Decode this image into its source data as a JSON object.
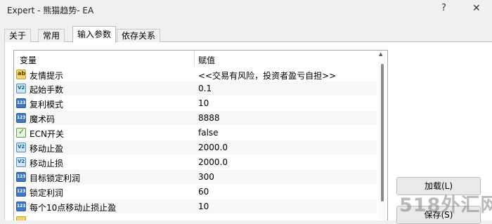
{
  "window": {
    "title": "Expert - 熊猫趋势- EA",
    "help": "?",
    "close": "✕"
  },
  "tabs": [
    {
      "label": "关于"
    },
    {
      "label": "常用"
    },
    {
      "label": "输入参数"
    },
    {
      "label": "依存关系"
    }
  ],
  "grid": {
    "columns": {
      "variable": "变量",
      "value": "赋值"
    },
    "rows": [
      {
        "name": "友情提示",
        "value": "<<交易有风险，投资者盈亏自担>>",
        "icon": "string-icon"
      },
      {
        "name": "起始手数",
        "value": "0.1",
        "icon": "double-icon"
      },
      {
        "name": "复利模式",
        "value": "10",
        "icon": "integer-icon"
      },
      {
        "name": "魔术码",
        "value": "8888",
        "icon": "integer-icon"
      },
      {
        "name": "ECN开关",
        "value": "false",
        "icon": "bool-icon"
      },
      {
        "name": "移动止盈",
        "value": "2000.0",
        "icon": "double-icon"
      },
      {
        "name": "移动止损",
        "value": "2000.0",
        "icon": "double-icon"
      },
      {
        "name": "目标锁定利润",
        "value": "300",
        "icon": "integer-icon"
      },
      {
        "name": "锁定利润",
        "value": "60",
        "icon": "integer-icon"
      },
      {
        "name": "每个10点移动止损止盈",
        "value": "10",
        "icon": "integer-icon"
      }
    ]
  },
  "buttons": {
    "load": "加载(L)",
    "save": "保存(S)"
  },
  "watermark": "518外汇网"
}
